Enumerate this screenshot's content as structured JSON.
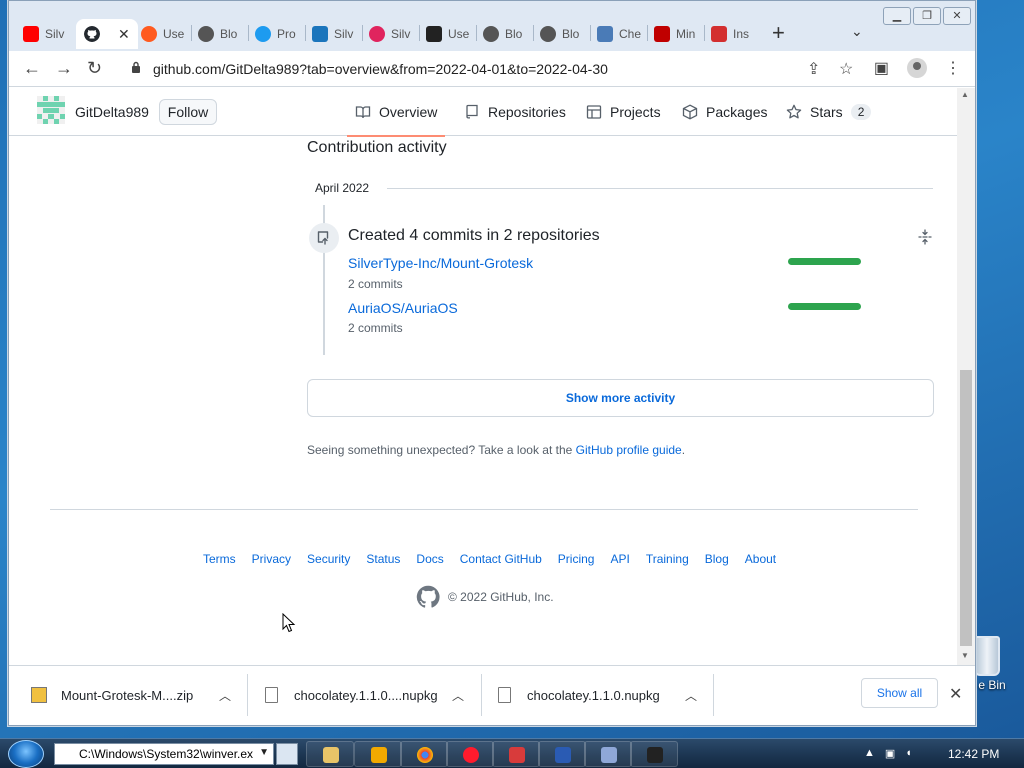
{
  "browser": {
    "tabs": [
      {
        "label": "Silv",
        "favicon_color": "#ff0000"
      },
      {
        "label": "",
        "favicon_color": "#24292f",
        "active": true
      },
      {
        "label": "Use",
        "favicon_color": "#ff5a1f"
      },
      {
        "label": "Blo",
        "favicon_color": "#555555"
      },
      {
        "label": "Pro",
        "favicon_color": "#1d9bf0"
      },
      {
        "label": "Silv",
        "favicon_color": "#1b75bc"
      },
      {
        "label": "Silv",
        "favicon_color": "#e0245e"
      },
      {
        "label": "Use",
        "favicon_color": "#222222"
      },
      {
        "label": "Blo",
        "favicon_color": "#555555"
      },
      {
        "label": "Blo",
        "favicon_color": "#555555"
      },
      {
        "label": "Che",
        "favicon_color": "#4a7bb7"
      },
      {
        "label": "Min",
        "favicon_color": "#c00000"
      },
      {
        "label": "Ins",
        "favicon_color": "#d32f2f"
      }
    ],
    "url": "github.com/GitDelta989?tab=overview&from=2022-04-01&to=2022-04-30"
  },
  "profile": {
    "username": "GitDelta989",
    "follow_label": "Follow",
    "nav": [
      {
        "label": "Overview",
        "icon": "book-icon",
        "selected": true
      },
      {
        "label": "Repositories",
        "icon": "repo-icon"
      },
      {
        "label": "Projects",
        "icon": "table-icon"
      },
      {
        "label": "Packages",
        "icon": "package-icon"
      },
      {
        "label": "Stars",
        "icon": "star-icon",
        "count": "2"
      }
    ]
  },
  "activity": {
    "title": "Contribution activity",
    "month": "April 2022",
    "summary": "Created 4 commits in 2 repositories",
    "repos": [
      {
        "name": "SilverType-Inc/Mount-Grotesk",
        "commits": "2 commits"
      },
      {
        "name": "AuriaOS/AuriaOS",
        "commits": "2 commits"
      }
    ],
    "show_more": "Show more activity",
    "unexpected_text": "Seeing something unexpected? Take a look at the",
    "guide_link": "GitHub profile guide",
    "guide_period": "."
  },
  "footer": {
    "links": [
      "Terms",
      "Privacy",
      "Security",
      "Status",
      "Docs",
      "Contact GitHub",
      "Pricing",
      "API",
      "Training",
      "Blog",
      "About"
    ],
    "copyright": "© 2022 GitHub, Inc."
  },
  "downloads": {
    "items": [
      "Mount-Grotesk-M....zip",
      "chocolatey.1.1.0....nupkg",
      "chocolatey.1.1.0.nupkg"
    ],
    "show_all": "Show all"
  },
  "desktop": {
    "recycle_label": "e Bin"
  },
  "taskbar": {
    "run_text": "C:\\Windows\\System32\\winver.ex",
    "time": "12:42 PM"
  }
}
